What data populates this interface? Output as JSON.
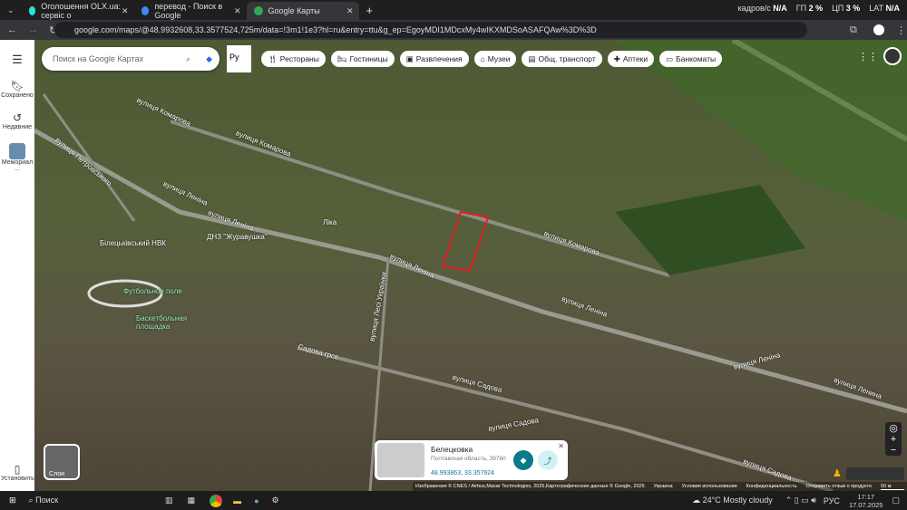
{
  "tabs": [
    {
      "title": "Оголошення OLX.ua: сервіс о",
      "color": "#23e5db"
    },
    {
      "title": "перевод - Поиск в Google",
      "color": "#4285f4"
    },
    {
      "title": "Google Карты",
      "color": "#34a853",
      "active": true
    }
  ],
  "new_tab": "+",
  "stats": {
    "fps_label": "кадров/с",
    "fps": "N/A",
    "gpu_label": "ГП",
    "gpu": "2 %",
    "cpu_label": "ЦП",
    "cpu": "3 %",
    "lat_label": "LAT",
    "lat": "N/A"
  },
  "url": "google.com/maps/@48.9932608,33.3577524,725m/data=!3m1!1e3?hl=ru&entry=ttu&g_ep=EgoyMDI1MDcxMy4wIKXMDSoASAFQAw%3D%3D",
  "sidebar": [
    {
      "label": "Сохранено"
    },
    {
      "label": "Недавние"
    },
    {
      "label": "Мемориал ..."
    },
    {
      "label": "Установить"
    }
  ],
  "search": {
    "placeholder": "Поиск на Google Картах"
  },
  "lang": "Ру",
  "chips": [
    "Рестораны",
    "Гостиницы",
    "Развлечения",
    "Музеи",
    "Общ. транспорт",
    "Аптеки",
    "Банкоматы"
  ],
  "map_labels": [
    "вулиця Комарова",
    "вулиця Комарова",
    "вулиця Комарова",
    "вулиця Леніна",
    "вулиця Леніна",
    "вулиця Леніна",
    "вулиця Леніна",
    "вулиця Леніна",
    "вулиця Петровського",
    "Білецьківський НВК",
    "ДНЗ \"Журавушка\"",
    "Ліка",
    "Футбольное поле",
    "Баскетбольная площадка",
    "Садова грсв",
    "вулиця Садова",
    "вулиця Садова",
    "вулиця Садова",
    "вулиця Лесі Українки",
    "вулиця Ленина"
  ],
  "layers_label": "Слои",
  "place": {
    "name": "Белецковка",
    "region": "Полтавская область, 39760",
    "coords": "48.993863, 33.357924"
  },
  "attribution": [
    "Изображения © CNES / Airbus,Maxar Technologies, 2025,Картографические данные © Google, 2025",
    "Украина",
    "Условия использования",
    "Конфиденциальность",
    "Отправить отзыв о продукте",
    "50 м"
  ],
  "taskbar": {
    "search": "Поиск",
    "weather": "24°C  Mostly cloudy",
    "lang": "РУС",
    "time": "17:17",
    "date": "17.07.2025"
  }
}
